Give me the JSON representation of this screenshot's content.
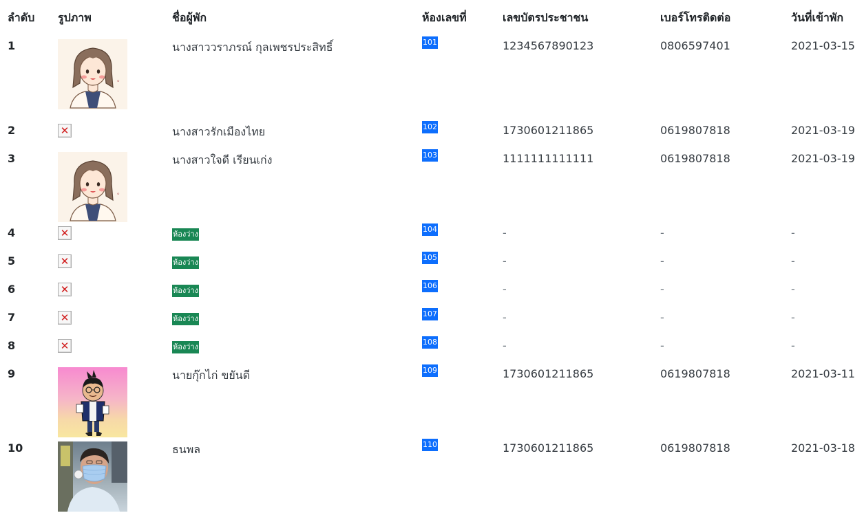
{
  "table": {
    "headers": [
      "ลำดับ",
      "รูปภาพ",
      "ชื่อผู้พัก",
      "ห้องเลขที่",
      "เลขบัตรประชาชน",
      "เบอร์โทรติดต่อ",
      "วันที่เข้าพัก"
    ],
    "rows": [
      {
        "no": "1",
        "photo": "girl-avatar-icon",
        "name": "นางสาววราภรณ์ กุลเพชรประสิทธิ์",
        "vacant": false,
        "room": "101",
        "id_card": "1234567890123",
        "phone": "0806597401",
        "date": "2021-03-15"
      },
      {
        "no": "2",
        "photo": "broken-image-icon",
        "name": "นางสาวรักเมืองไทย",
        "vacant": false,
        "room": "102",
        "id_card": "1730601211865",
        "phone": "0619807818",
        "date": "2021-03-19"
      },
      {
        "no": "3",
        "photo": "girl-avatar-icon",
        "name": "นางสาวใจดี เรียนเก่ง",
        "vacant": false,
        "room": "103",
        "id_card": "1111111111111",
        "phone": "0619807818",
        "date": "2021-03-19"
      },
      {
        "no": "4",
        "photo": "broken-image-icon",
        "name": "ห้องว่าง",
        "vacant": true,
        "room": "104",
        "id_card": "-",
        "phone": "-",
        "date": "-"
      },
      {
        "no": "5",
        "photo": "broken-image-icon",
        "name": "ห้องว่าง",
        "vacant": true,
        "room": "105",
        "id_card": "-",
        "phone": "-",
        "date": "-"
      },
      {
        "no": "6",
        "photo": "broken-image-icon",
        "name": "ห้องว่าง",
        "vacant": true,
        "room": "106",
        "id_card": "-",
        "phone": "-",
        "date": "-"
      },
      {
        "no": "7",
        "photo": "broken-image-icon",
        "name": "ห้องว่าง",
        "vacant": true,
        "room": "107",
        "id_card": "-",
        "phone": "-",
        "date": "-"
      },
      {
        "no": "8",
        "photo": "broken-image-icon",
        "name": "ห้องว่าง",
        "vacant": true,
        "room": "108",
        "id_card": "-",
        "phone": "-",
        "date": "-"
      },
      {
        "no": "9",
        "photo": "cartoon-boy-avatar-icon",
        "name": "นายกุ๊กไก่ ขยันดี",
        "vacant": false,
        "room": "109",
        "id_card": "1730601211865",
        "phone": "0619807818",
        "date": "2021-03-11"
      },
      {
        "no": "10",
        "photo": "person-with-mask-photo",
        "name": "ธนพล",
        "vacant": false,
        "room": "110",
        "id_card": "1730601211865",
        "phone": "0619807818",
        "date": "2021-03-18"
      }
    ]
  },
  "colors": {
    "room_badge": "#0d6efd",
    "vacant_badge": "#198754",
    "broken_x": "#d01b1b"
  }
}
